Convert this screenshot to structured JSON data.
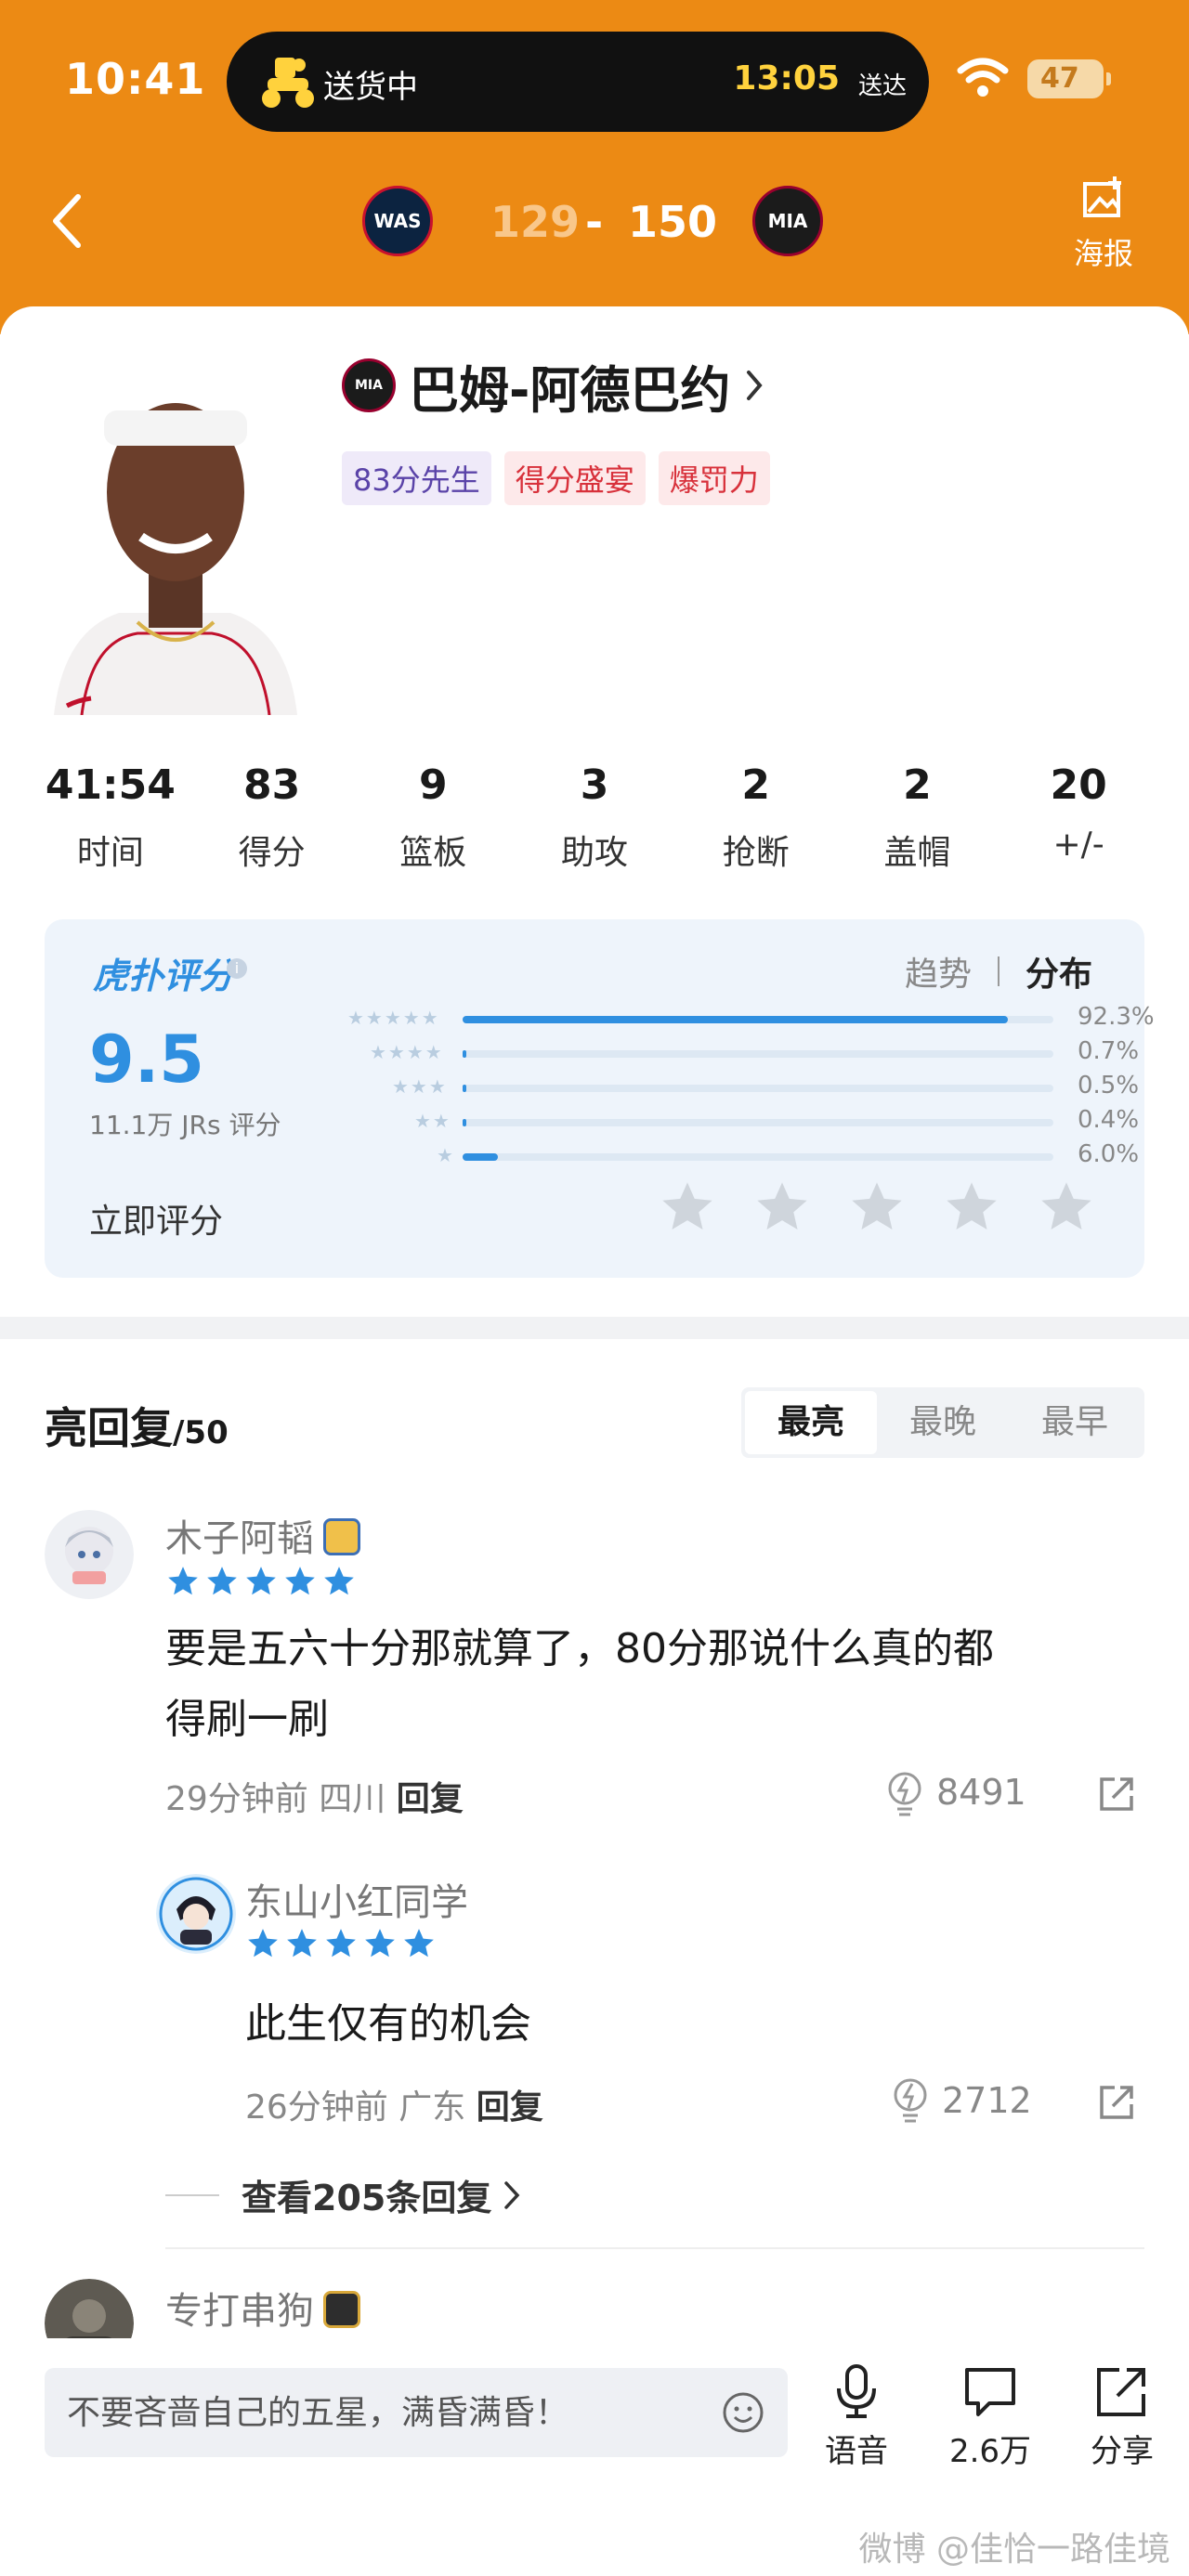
{
  "status_bar": {
    "time": "10:41",
    "island_status": "送货中",
    "island_eta_time": "13:05",
    "island_eta_label": "送达",
    "battery": "47"
  },
  "match": {
    "home_team": "WAS",
    "home_score": "129",
    "separator": "-",
    "away_score": "150",
    "away_team": "MIA",
    "poster_label": "海报"
  },
  "player": {
    "team_logo": "MIA",
    "name": "巴姆-阿德巴约",
    "tags": [
      "83分先生",
      "得分盛宴",
      "爆罚力"
    ]
  },
  "stats": [
    {
      "value": "41:54",
      "label": "时间"
    },
    {
      "value": "83",
      "label": "得分"
    },
    {
      "value": "9",
      "label": "篮板"
    },
    {
      "value": "3",
      "label": "助攻"
    },
    {
      "value": "2",
      "label": "抢断"
    },
    {
      "value": "2",
      "label": "盖帽"
    },
    {
      "value": "20",
      "label": "+/-"
    }
  ],
  "rating": {
    "brand": "虎扑评分",
    "score": "9.5",
    "count_label": "11.1万 JRs 评分",
    "tab_trend": "趋势",
    "tab_distribution": "分布",
    "distribution": [
      {
        "stars": 5,
        "percent_label": "92.3%",
        "fraction": 0.923
      },
      {
        "stars": 4,
        "percent_label": "0.7%",
        "fraction": 0.007
      },
      {
        "stars": 3,
        "percent_label": "0.5%",
        "fraction": 0.005
      },
      {
        "stars": 2,
        "percent_label": "0.4%",
        "fraction": 0.004
      },
      {
        "stars": 1,
        "percent_label": "6.0%",
        "fraction": 0.06
      }
    ],
    "rate_now_label": "立即评分"
  },
  "replies": {
    "title": "亮回复",
    "count": "/50",
    "sort_tabs": [
      "最亮",
      "最晚",
      "最早"
    ],
    "active_sort": "最亮",
    "items": [
      {
        "user": "木子阿韬",
        "text_line1": "要是五六十分那就算了，80分那说什么真的都",
        "text_line2": "得刷一刷",
        "time": "29分钟前",
        "location": "四川",
        "reply_label": "回复",
        "lights": "8491"
      },
      {
        "user": "东山小红同学",
        "text_line1": "此生仅有的机会",
        "time": "26分钟前",
        "location": "广东",
        "reply_label": "回复",
        "lights": "2712"
      },
      {
        "user": "专打串狗"
      }
    ],
    "view_more": "查看205条回复"
  },
  "bottom_bar": {
    "input_placeholder": "不要吝啬自己的五星，满昏满昏！",
    "voice_label": "语音",
    "comments_count": "2.6万",
    "share_label": "分享"
  },
  "watermark": "微博 @佳恰一路佳境",
  "colors": {
    "header": "#ec8a14",
    "accent_blue": "#2f8fe0",
    "tag_red": "#d8313b",
    "tag_purple": "#5a43a8"
  }
}
